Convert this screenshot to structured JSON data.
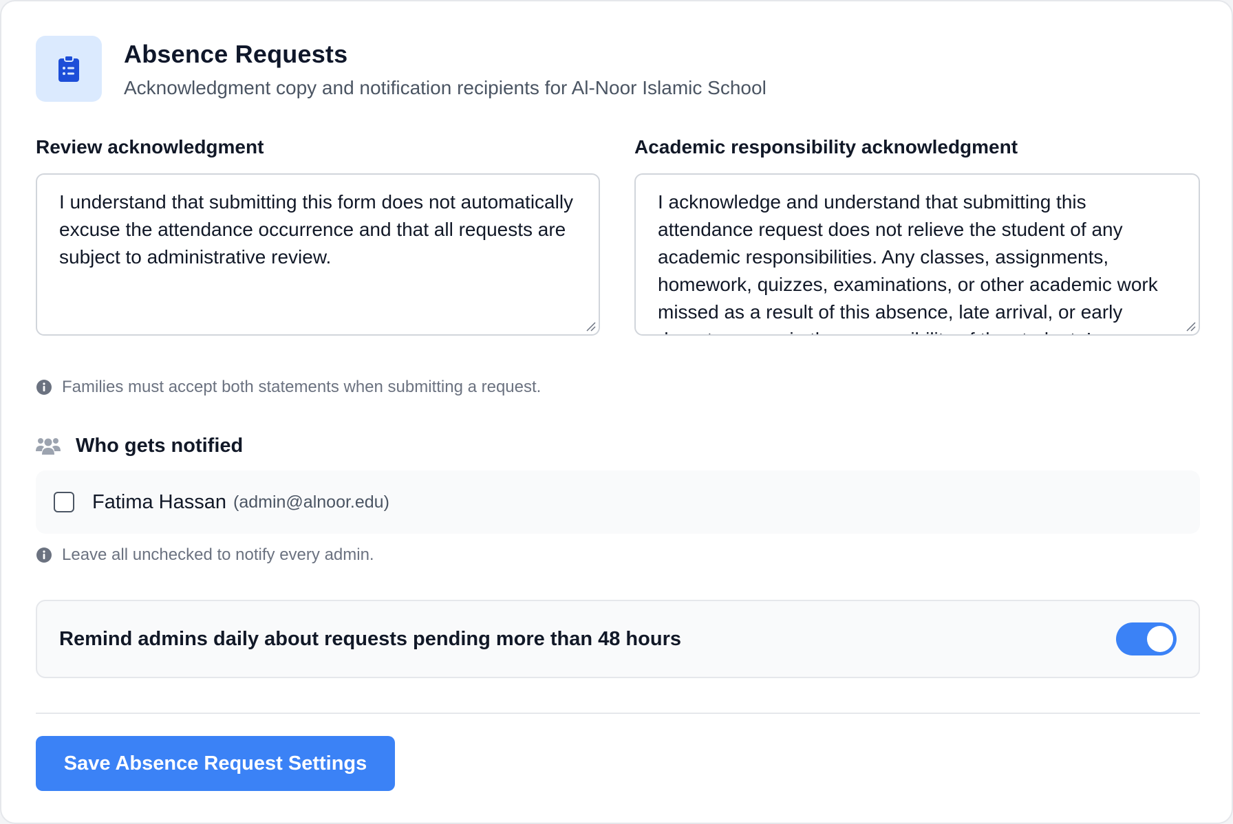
{
  "header": {
    "icon": "clipboard-list-icon",
    "title": "Absence Requests",
    "subtitle": "Acknowledgment copy and notification recipients for Al-Noor Islamic School"
  },
  "review_ack": {
    "label": "Review acknowledgment",
    "value": "I understand that submitting this form does not automatically excuse the attendance occurrence and that all requests are subject to administrative review."
  },
  "academic_ack": {
    "label": "Academic responsibility acknowledgment",
    "value": "I acknowledge and understand that submitting this attendance request does not relieve the student of any academic responsibilities. Any classes, assignments, homework, quizzes, examinations, or other academic work missed as a result of this absence, late arrival, or early departure remain the responsibility of the student. I"
  },
  "ack_hint": "Families must accept both statements when submitting a request.",
  "notify": {
    "heading": "Who gets notified",
    "icon": "users-icon",
    "recipients": [
      {
        "name": "Fatima Hassan",
        "email": "(admin@alnoor.edu)",
        "checked": false
      }
    ],
    "hint": "Leave all unchecked to notify every admin."
  },
  "reminder": {
    "label": "Remind admins daily about requests pending more than 48 hours",
    "enabled": true
  },
  "save_button": "Save Absence Request Settings",
  "colors": {
    "accent": "#3b82f6",
    "icon_bg": "#dbeafe",
    "icon_fg": "#1d4ed8"
  }
}
